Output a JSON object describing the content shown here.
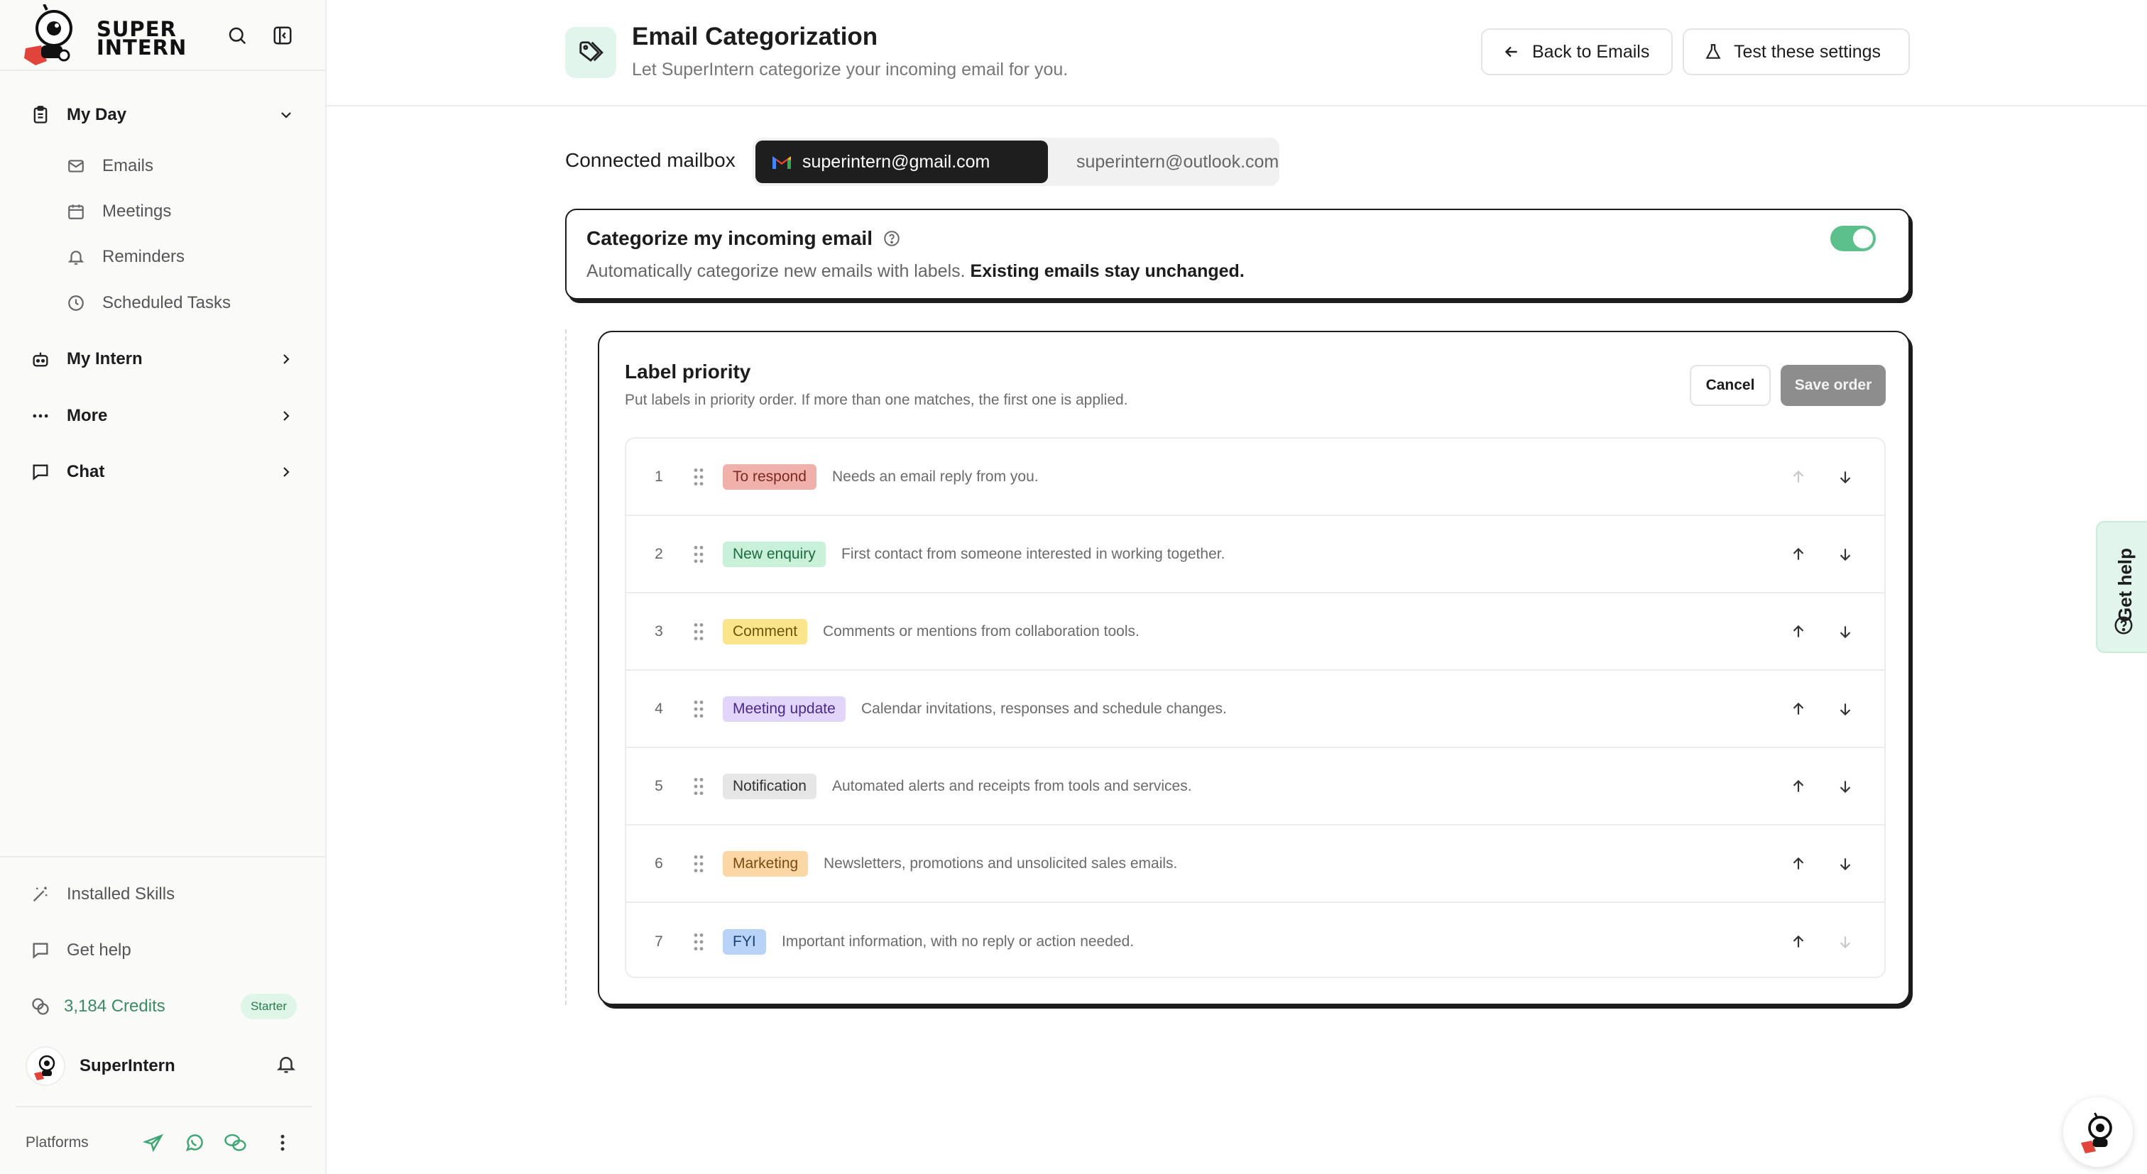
{
  "sidebar": {
    "logo_text_line1": "SUPER",
    "logo_text_line2": "INTERN",
    "nav": [
      {
        "label": "My Day",
        "icon": "clipboard-icon",
        "expanded": true,
        "children": [
          {
            "label": "Emails",
            "icon": "mail-icon"
          },
          {
            "label": "Meetings",
            "icon": "calendar-icon"
          },
          {
            "label": "Reminders",
            "icon": "bell-icon"
          },
          {
            "label": "Scheduled Tasks",
            "icon": "clock-icon"
          }
        ]
      },
      {
        "label": "My Intern",
        "icon": "bot-icon"
      },
      {
        "label": "More",
        "icon": "ellipsis-icon"
      },
      {
        "label": "Chat",
        "icon": "chat-bubble-icon"
      }
    ],
    "bottom": {
      "installed_skills": "Installed Skills",
      "get_help": "Get help",
      "credits": "3,184 Credits",
      "plan": "Starter",
      "user_name": "SuperIntern",
      "platforms_label": "Platforms"
    }
  },
  "header": {
    "title": "Email Categorization",
    "subtitle": "Let SuperIntern categorize your incoming email for you.",
    "back_button": "Back to Emails",
    "test_button": "Test these settings"
  },
  "mailbox": {
    "label": "Connected mailbox",
    "accounts": [
      {
        "email": "superintern@gmail.com",
        "provider": "gmail",
        "active": true
      },
      {
        "email": "superintern@outlook.com",
        "provider": "outlook",
        "active": false
      }
    ]
  },
  "categorize": {
    "title": "Categorize my incoming email",
    "description": "Automatically categorize new emails with labels.",
    "description_bold": "Existing emails stay unchanged.",
    "enabled": true
  },
  "priority": {
    "title": "Label priority",
    "description": "Put labels in priority order. If more than one matches, the first one is applied.",
    "cancel": "Cancel",
    "save": "Save order",
    "labels": [
      {
        "num": "1",
        "name": "To respond",
        "desc": "Needs an email reply from you.",
        "bg": "#f0b1aa",
        "fg": "#7a2a22"
      },
      {
        "num": "2",
        "name": "New enquiry",
        "desc": "First contact from someone interested in working together.",
        "bg": "#c9f0d8",
        "fg": "#1f6b40"
      },
      {
        "num": "3",
        "name": "Comment",
        "desc": "Comments or mentions from collaboration tools.",
        "bg": "#fbe58c",
        "fg": "#6b5608"
      },
      {
        "num": "4",
        "name": "Meeting update",
        "desc": "Calendar invitations, responses and schedule changes.",
        "bg": "#e2d5fa",
        "fg": "#4a2a8a"
      },
      {
        "num": "5",
        "name": "Notification",
        "desc": "Automated alerts and receipts from tools and services.",
        "bg": "#e6e6e6",
        "fg": "#333333"
      },
      {
        "num": "6",
        "name": "Marketing",
        "desc": "Newsletters, promotions and unsolicited sales emails.",
        "bg": "#fcd7a6",
        "fg": "#7a4a10"
      },
      {
        "num": "7",
        "name": "FYI",
        "desc": "Important information, with no reply or action needed.",
        "bg": "#b9d3f7",
        "fg": "#1d3f7a"
      }
    ]
  },
  "help_tab": "Get help",
  "colors": {
    "accent_green": "#5cc08c",
    "dark": "#1c1c1c"
  }
}
